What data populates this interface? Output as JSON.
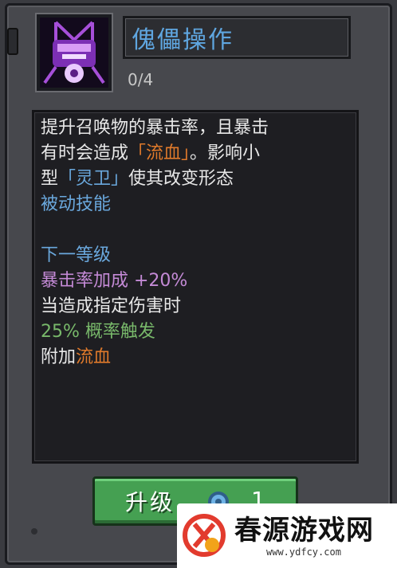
{
  "skill": {
    "title": "傀儡操作",
    "level": "0/4",
    "icon": "puppet-skill-icon"
  },
  "description": {
    "line1": "提升召唤物的暴击率，且暴击",
    "line2_a": "有时会造成",
    "line2_b": "「流血」",
    "line2_c": "。影响小",
    "line3_a": "型",
    "line3_b": "「灵卫」",
    "line3_c": "使其改变形态",
    "passive": "被动技能",
    "next_level_heading": "下一等级",
    "bonus": "暴击率加成 +20%",
    "condition": "当造成指定伤害时",
    "chance": "25% 概率触发",
    "effect_a": "附加",
    "effect_b": "流血"
  },
  "button": {
    "label": "升级",
    "cost": "1",
    "cost_icon": "gem-icon"
  },
  "watermark": {
    "name": "春源游戏网",
    "url": "www.ydfcy.com"
  },
  "colors": {
    "title": "#5fa6e0",
    "orange_keyword": "#e07a2b",
    "blue_keyword": "#6aa8dd",
    "purple_bonus": "#c48ad6",
    "green_chance": "#78b86a",
    "button_green": "#45a052"
  }
}
